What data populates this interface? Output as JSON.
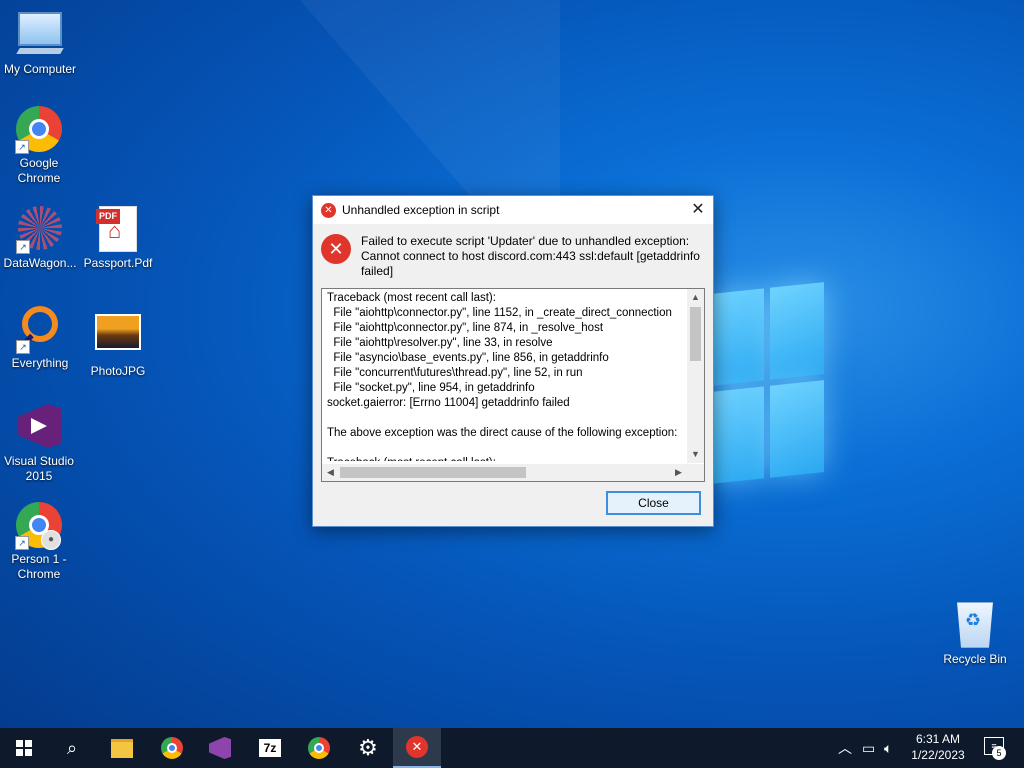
{
  "desktop": {
    "icons": [
      {
        "label": "My Computer",
        "icon": "computer-icon"
      },
      {
        "label": "Google Chrome",
        "icon": "chrome-icon"
      },
      {
        "label": "DataWagon...",
        "icon": "datawagon-icon"
      },
      {
        "label": "Passport.Pdf",
        "icon": "pdf-icon"
      },
      {
        "label": "Everything",
        "icon": "everything-icon"
      },
      {
        "label": "PhotoJPG",
        "icon": "photo-icon"
      },
      {
        "label": "Visual Studio 2015",
        "icon": "visual-studio-icon"
      },
      {
        "label": "Person 1 - Chrome",
        "icon": "chrome-profile-icon"
      },
      {
        "label": "Recycle Bin",
        "icon": "recycle-bin-icon"
      }
    ],
    "pdf_badge": "PDF"
  },
  "dialog": {
    "title": "Unhandled exception in script",
    "message": "Failed to execute script 'Updater' due to unhandled exception:\nCannot connect to host discord.com:443 ssl:default [getaddrinfo failed]",
    "traceback": [
      "Traceback (most recent call last):",
      "  File \"aiohttp\\connector.py\", line 1152, in _create_direct_connection",
      "  File \"aiohttp\\connector.py\", line 874, in _resolve_host",
      "  File \"aiohttp\\resolver.py\", line 33, in resolve",
      "  File \"asyncio\\base_events.py\", line 856, in getaddrinfo",
      "  File \"concurrent\\futures\\thread.py\", line 52, in run",
      "  File \"socket.py\", line 954, in getaddrinfo",
      "socket.gaierror: [Errno 11004] getaddrinfo failed",
      "",
      "The above exception was the direct cause of the following exception:",
      "",
      "Traceback (most recent call last):"
    ],
    "close_button": "Close",
    "close_glyph": "✕"
  },
  "taskbar": {
    "items": [
      "start-button",
      "search-icon",
      "file-explorer-icon",
      "chrome-icon",
      "visual-studio-icon",
      "7zip-icon",
      "chrome-profile-icon",
      "settings-icon",
      "error-app-icon"
    ],
    "seven_zip_label": "7z",
    "tray": {
      "time": "6:31 AM",
      "date": "1/22/2023",
      "notifications_count": "5"
    }
  },
  "colors": {
    "accent": "#3c8ee0",
    "error": "#e0352b",
    "taskbar": "#0e1a2b"
  }
}
